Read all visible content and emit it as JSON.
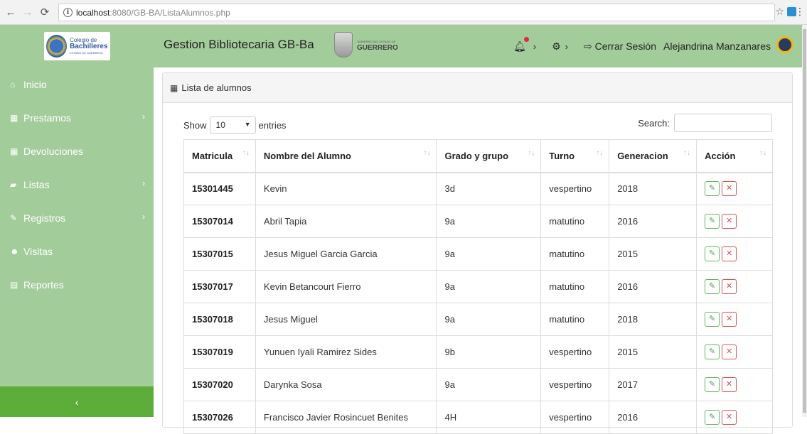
{
  "browser": {
    "url_host": "localhost",
    "url_path": ":8080/GB-BA/ListaAlumnos.php"
  },
  "brand": {
    "logo_line1": "Colegio de",
    "logo_line2": "Bachilleres",
    "logo_line3": "ESTADO DE GUERRERO"
  },
  "header": {
    "title": "Gestion Bibliotecaria GB-Ba",
    "state_small": "GOBIERNO DEL ESTADO DE",
    "state_name": "GUERRERO",
    "logout_label": "Cerrar Sesión",
    "user_name": "Alejandrina Manzanares"
  },
  "sidebar": {
    "items": [
      {
        "label": "Inicio",
        "icon": "home-icon"
      },
      {
        "label": "Prestamos",
        "icon": "calendar-icon"
      },
      {
        "label": "Devoluciones",
        "icon": "calendar-icon"
      },
      {
        "label": "Listas",
        "icon": "book-icon"
      },
      {
        "label": "Registros",
        "icon": "edit-icon"
      },
      {
        "label": "Visitas",
        "icon": "users-icon"
      },
      {
        "label": "Reportes",
        "icon": "file-icon"
      }
    ]
  },
  "panel": {
    "title": "Lista de alumnos",
    "show_label": "Show",
    "entries_value": "10",
    "entries_label": "entries",
    "search_label": "Search:",
    "search_value": ""
  },
  "table": {
    "headers": [
      "Matricula",
      "Nombre del Alumno",
      "Grado y grupo",
      "Turno",
      "Generacion",
      "Acción"
    ],
    "rows": [
      [
        "15301445",
        "Kevin",
        "3d",
        "vespertino",
        "2018"
      ],
      [
        "15307014",
        "Abril Tapia",
        "9a",
        "matutino",
        "2016"
      ],
      [
        "15307015",
        "Jesus Miguel Garcia Garcia",
        "9a",
        "matutino",
        "2015"
      ],
      [
        "15307017",
        "Kevin Betancourt Fierro",
        "9a",
        "matutino",
        "2016"
      ],
      [
        "15307018",
        "Jesus Miguel",
        "9a",
        "matutino",
        "2018"
      ],
      [
        "15307019",
        "Yunuen Iyali Ramirez Sides",
        "9b",
        "vespertino",
        "2015"
      ],
      [
        "15307020",
        "Darynka Sosa",
        "9a",
        "vespertino",
        "2017"
      ],
      [
        "15307026",
        "Francisco Javier Rosincuet Benites",
        "4H",
        "vespertino",
        "2016"
      ]
    ]
  },
  "colors": {
    "sidebar_bg": "#a3cc9b",
    "collapse_bg": "#5cad3a",
    "edit": "#5cb85c",
    "delete": "#d9534f"
  }
}
